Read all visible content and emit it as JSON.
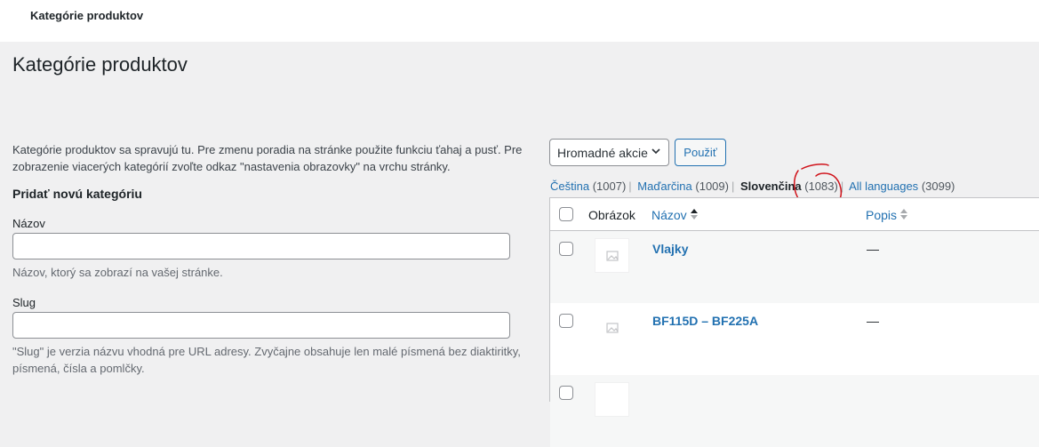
{
  "topbar": {
    "title": "Kategórie produktov"
  },
  "page": {
    "title": "Kategórie produktov"
  },
  "intro": {
    "text": "Kategórie produktov sa spravujú tu. Pre zmenu poradia na stránke použite funkciu ťahaj a pusť. Pre zobrazenie viacerých kategórií zvoľte odkaz \"nastavenia obrazovky\" na vrchu stránky."
  },
  "add_form": {
    "heading": "Pridať novú kategóriu",
    "name": {
      "label": "Názov",
      "value": "",
      "description": "Názov, ktorý sa zobrazí na vašej stránke."
    },
    "slug": {
      "label": "Slug",
      "value": "",
      "description": "\"Slug\" je verzia názvu vhodná pre URL adresy. Zvyčajne obsahuje len malé písmená bez diaktiritky, písmená, čísla a pomlčky."
    }
  },
  "bulk": {
    "selected": "Hromadné akcie",
    "apply_label": "Použiť"
  },
  "languages": [
    {
      "label": "Čeština",
      "count": "(1007)",
      "current": false
    },
    {
      "label": "Maďarčina",
      "count": "(1009)",
      "current": false
    },
    {
      "label": "Slovenčina",
      "count": "(1083)",
      "current": true
    },
    {
      "label": "All languages",
      "count": "(3099)",
      "current": false
    }
  ],
  "table": {
    "columns": {
      "image": "Obrázok",
      "name": "Názov",
      "description": "Popis"
    },
    "rows": [
      {
        "name": "Vlajky",
        "description": "—"
      },
      {
        "name": "BF115D – BF225A",
        "description": "—"
      }
    ]
  },
  "colors": {
    "accent": "#2271b1",
    "annotation": "#d0131b",
    "background": "#f0f0f1"
  }
}
